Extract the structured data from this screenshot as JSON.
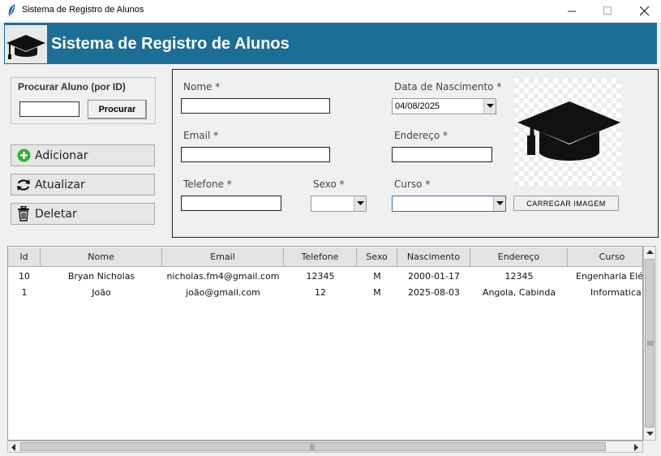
{
  "window": {
    "title": "Sistema de Registro de Alunos"
  },
  "banner": {
    "title": "Sistema de Registro de Alunos",
    "color": "#1d6e96"
  },
  "search": {
    "label": "Procurar Aluno (por ID)",
    "value": "",
    "button": "Procurar"
  },
  "actions": [
    {
      "label": "Adicionar",
      "icon": "plus-circle-icon"
    },
    {
      "label": "Atualizar",
      "icon": "refresh-icon"
    },
    {
      "label": "Deletar",
      "icon": "trash-icon"
    }
  ],
  "form": {
    "nome_label": "Nome *",
    "nascimento_label": "Data de Nascimento *",
    "nascimento_value": "04/08/2025",
    "email_label": "Email *",
    "endereco_label": "Endereço *",
    "telefone_label": "Telefone *",
    "sexo_label": "Sexo *",
    "sexo_value": "",
    "curso_label": "Curso *",
    "curso_value": "",
    "upload_button": "CARREGAR IMAGEM"
  },
  "table": {
    "columns": [
      "Id",
      "Nome",
      "Email",
      "Telefone",
      "Sexo",
      "Nascimento",
      "Endereço",
      "Curso"
    ],
    "rows": [
      [
        "10",
        "Bryan Nicholas",
        "nicholas.fm4@gmail.com",
        "12345",
        "M",
        "2000-01-17",
        "12345",
        "Engenharia Elét"
      ],
      [
        "1",
        "João",
        "joão@gmail.com",
        "12",
        "M",
        "2025-08-03",
        "Angola, Cabinda",
        "Informatica"
      ]
    ]
  }
}
